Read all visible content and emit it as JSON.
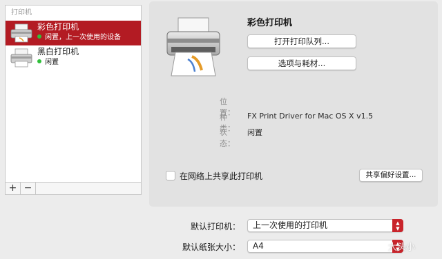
{
  "printer_list": {
    "header": "打印机",
    "items": [
      {
        "name": "彩色打印机",
        "status": "闲置，上一次使用的设备",
        "selected": true,
        "icon": "printer-icon"
      },
      {
        "name": "黑白打印机",
        "status": "闲置",
        "selected": false,
        "icon": "printer-icon"
      }
    ],
    "add_label": "+",
    "remove_label": "−"
  },
  "details": {
    "title": "彩色打印机",
    "open_queue_label": "打开打印队列...",
    "options_label": "选项与耗材...",
    "location_label": "位置：",
    "location_value": "",
    "kind_label": "种类：",
    "kind_value": "FX Print Driver for Mac OS X v1.5",
    "status_label": "状态：",
    "status_value": "闲置",
    "share_label": "在网络上共享此打印机",
    "share_checked": false,
    "share_prefs_label": "共享偏好设置..."
  },
  "defaults": {
    "printer_label": "默认打印机：",
    "printer_value": "上一次使用的打印机",
    "paper_label": "默认纸张大小：",
    "paper_value": "A4"
  },
  "watermark": "大头小",
  "colors": {
    "selection": "#b31b23",
    "status_dot": "#2fbf3a",
    "popup_arrow": "#c9242b"
  }
}
